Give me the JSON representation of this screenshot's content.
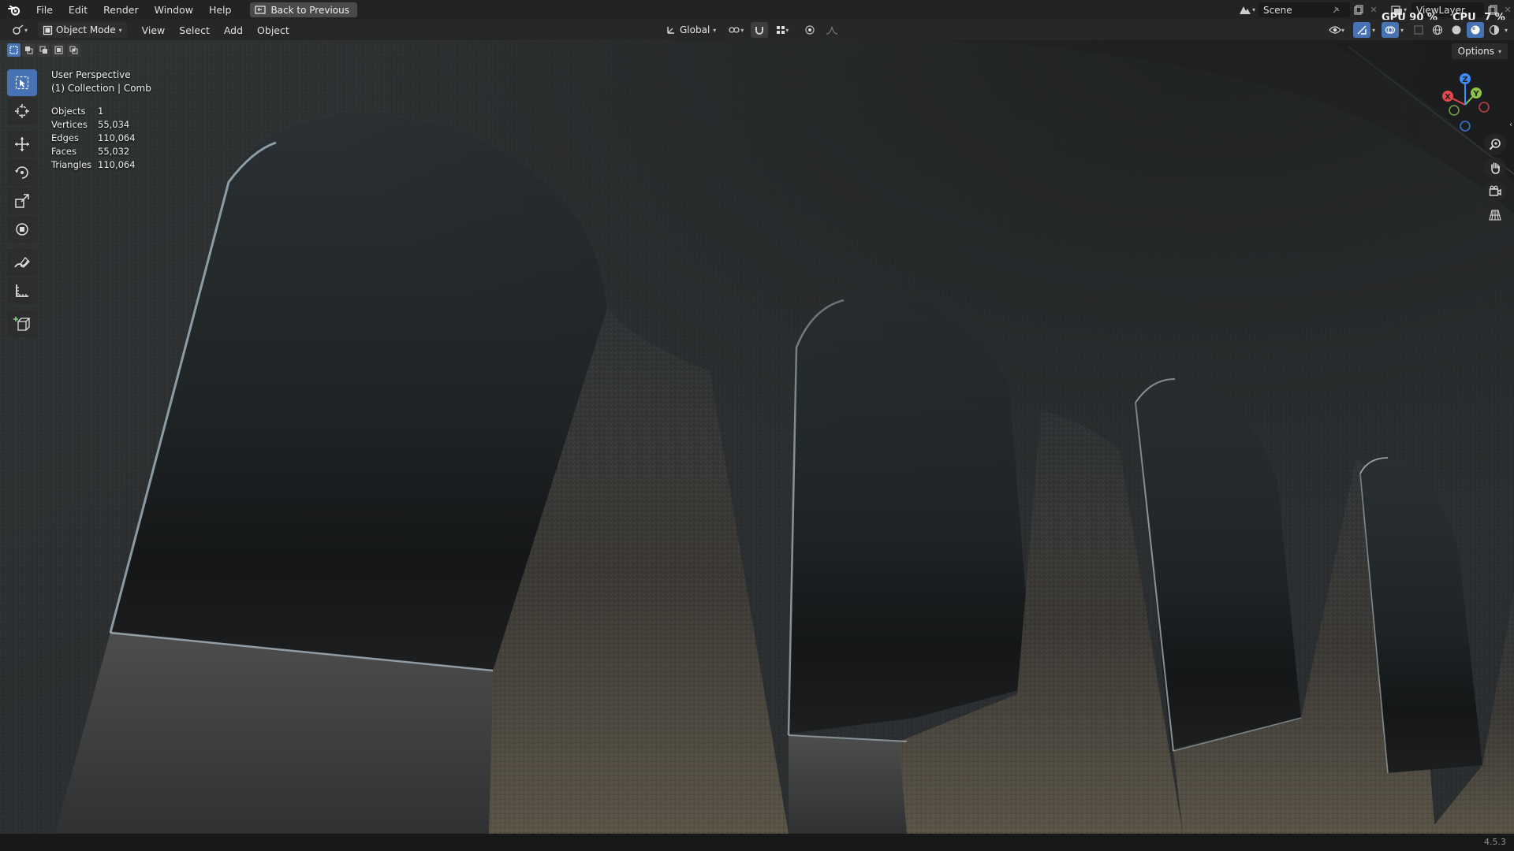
{
  "menubar": {
    "items": [
      "File",
      "Edit",
      "Render",
      "Window",
      "Help"
    ],
    "back_button": "Back to Previous",
    "scene_label": "Scene",
    "viewlayer_label": "ViewLayer",
    "gpu_label": "GPU",
    "gpu_value": "90 %",
    "cpu_label": "CPU",
    "cpu_value": "7 %"
  },
  "header": {
    "mode": "Object Mode",
    "menus": [
      "View",
      "Select",
      "Add",
      "Object"
    ],
    "transform_orientation": "Global"
  },
  "viewport": {
    "perspective": "User Perspective",
    "collection": "(1) Collection | Comb",
    "stats": [
      {
        "label": "Objects",
        "value": "1"
      },
      {
        "label": "Vertices",
        "value": "55,034"
      },
      {
        "label": "Edges",
        "value": "110,064"
      },
      {
        "label": "Faces",
        "value": "55,032"
      },
      {
        "label": "Triangles",
        "value": "110,064"
      }
    ],
    "options_label": "Options",
    "gizmo": {
      "x": "X",
      "y": "Y",
      "z": "Z",
      "x_color": "#e5484d",
      "y_color": "#8bc34a",
      "z_color": "#3d8bfd"
    }
  },
  "toolbar": {
    "tools": [
      "select-box-tool",
      "cursor-tool",
      "move-tool",
      "rotate-tool",
      "scale-tool",
      "transform-tool",
      "annotate-tool",
      "measure-tool",
      "add-cube-tool"
    ],
    "active_tool": "select-box-tool"
  },
  "status": {
    "version": "4.5.3"
  },
  "colors": {
    "accent": "#4772b3",
    "menubar": "#232323",
    "header": "#282828"
  }
}
